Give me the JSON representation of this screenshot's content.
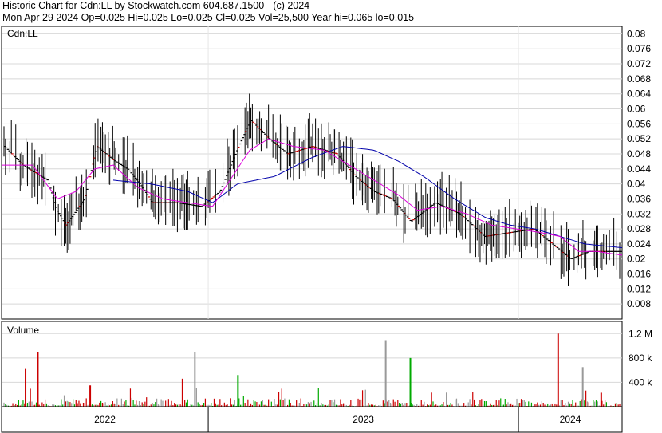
{
  "header": {
    "title_line": "Historic Chart for Cdn:LL by Stockwatch.com 604.687.1500 - (c) 2024",
    "quote_line": "Mon Apr 29 2024   Op=0.025  Hi=0.025  Lo=0.025  Cl=0.025  Vol=25,500   Year hi=0.065   lo=0.015"
  },
  "chart_data": [
    {
      "type": "line",
      "symbol_label": "Cdn:LL",
      "y_ticks": [
        "0.08",
        "0.076",
        "0.072",
        "0.068",
        "0.064",
        "0.06",
        "0.056",
        "0.052",
        "0.048",
        "0.044",
        "0.04",
        "0.036",
        "0.032",
        "0.028",
        "0.024",
        "0.02",
        "0.016",
        "0.012",
        "0.008"
      ],
      "ylim": [
        0.004,
        0.082
      ],
      "x_labels": [
        "2022",
        "2023",
        "2024"
      ],
      "grid": true,
      "colors": {
        "bar": "#000000",
        "close_red": "#cc0000",
        "ma_short": "#dd00dd",
        "ma_long": "#0000aa"
      },
      "close_profile": [
        [
          0,
          0.05
        ],
        [
          0.03,
          0.045
        ],
        [
          0.07,
          0.041
        ],
        [
          0.085,
          0.033
        ],
        [
          0.1,
          0.029
        ],
        [
          0.13,
          0.036
        ],
        [
          0.15,
          0.05
        ],
        [
          0.18,
          0.046
        ],
        [
          0.2,
          0.044
        ],
        [
          0.22,
          0.04
        ],
        [
          0.24,
          0.035
        ],
        [
          0.28,
          0.035
        ],
        [
          0.32,
          0.034
        ],
        [
          0.35,
          0.038
        ],
        [
          0.38,
          0.05
        ],
        [
          0.4,
          0.057
        ],
        [
          0.43,
          0.052
        ],
        [
          0.46,
          0.048
        ],
        [
          0.5,
          0.05
        ],
        [
          0.54,
          0.048
        ],
        [
          0.57,
          0.042
        ],
        [
          0.6,
          0.038
        ],
        [
          0.63,
          0.036
        ],
        [
          0.66,
          0.03
        ],
        [
          0.7,
          0.035
        ],
        [
          0.74,
          0.032
        ],
        [
          0.78,
          0.026
        ],
        [
          0.82,
          0.027
        ],
        [
          0.86,
          0.028
        ],
        [
          0.89,
          0.024
        ],
        [
          0.92,
          0.02
        ],
        [
          0.95,
          0.022
        ],
        [
          1.0,
          0.022
        ]
      ],
      "ma_short": [
        [
          0,
          0.045
        ],
        [
          0.05,
          0.045
        ],
        [
          0.09,
          0.036
        ],
        [
          0.12,
          0.038
        ],
        [
          0.15,
          0.044
        ],
        [
          0.18,
          0.045
        ],
        [
          0.22,
          0.039
        ],
        [
          0.26,
          0.036
        ],
        [
          0.3,
          0.035
        ],
        [
          0.34,
          0.034
        ],
        [
          0.36,
          0.039
        ],
        [
          0.4,
          0.049
        ],
        [
          0.43,
          0.052
        ],
        [
          0.47,
          0.05
        ],
        [
          0.52,
          0.049
        ],
        [
          0.56,
          0.045
        ],
        [
          0.6,
          0.041
        ],
        [
          0.64,
          0.037
        ],
        [
          0.67,
          0.033
        ],
        [
          0.71,
          0.034
        ],
        [
          0.75,
          0.032
        ],
        [
          0.79,
          0.029
        ],
        [
          0.83,
          0.028
        ],
        [
          0.87,
          0.027
        ],
        [
          0.9,
          0.026
        ],
        [
          0.93,
          0.022
        ],
        [
          0.96,
          0.022
        ],
        [
          1.0,
          0.021
        ]
      ],
      "ma_long": [
        [
          0.18,
          0.041
        ],
        [
          0.24,
          0.04
        ],
        [
          0.3,
          0.038
        ],
        [
          0.34,
          0.035
        ],
        [
          0.38,
          0.04
        ],
        [
          0.44,
          0.042
        ],
        [
          0.5,
          0.047
        ],
        [
          0.55,
          0.05
        ],
        [
          0.6,
          0.049
        ],
        [
          0.64,
          0.046
        ],
        [
          0.68,
          0.042
        ],
        [
          0.73,
          0.036
        ],
        [
          0.78,
          0.031
        ],
        [
          0.82,
          0.029
        ],
        [
          0.86,
          0.028
        ],
        [
          0.9,
          0.026
        ],
        [
          0.94,
          0.024
        ],
        [
          1.0,
          0.023
        ]
      ]
    },
    {
      "type": "bar",
      "title": "Volume",
      "y_ticks": [
        "1.2 M",
        "800 k",
        "400 k"
      ],
      "ylim": [
        0,
        1400000
      ],
      "colors": {
        "down": "#cc0000",
        "up": "#00aa00",
        "flat": "#999999"
      },
      "spikes": [
        [
          0.035,
          620000,
          "down"
        ],
        [
          0.055,
          900000,
          "down"
        ],
        [
          0.14,
          350000,
          "down"
        ],
        [
          0.29,
          460000,
          "down"
        ],
        [
          0.31,
          900000,
          "flat"
        ],
        [
          0.38,
          520000,
          "up"
        ],
        [
          0.62,
          1080000,
          "flat"
        ],
        [
          0.66,
          800000,
          "up"
        ],
        [
          0.9,
          1200000,
          "down"
        ],
        [
          0.94,
          650000,
          "flat"
        ],
        [
          0.97,
          230000,
          "down"
        ]
      ]
    }
  ]
}
